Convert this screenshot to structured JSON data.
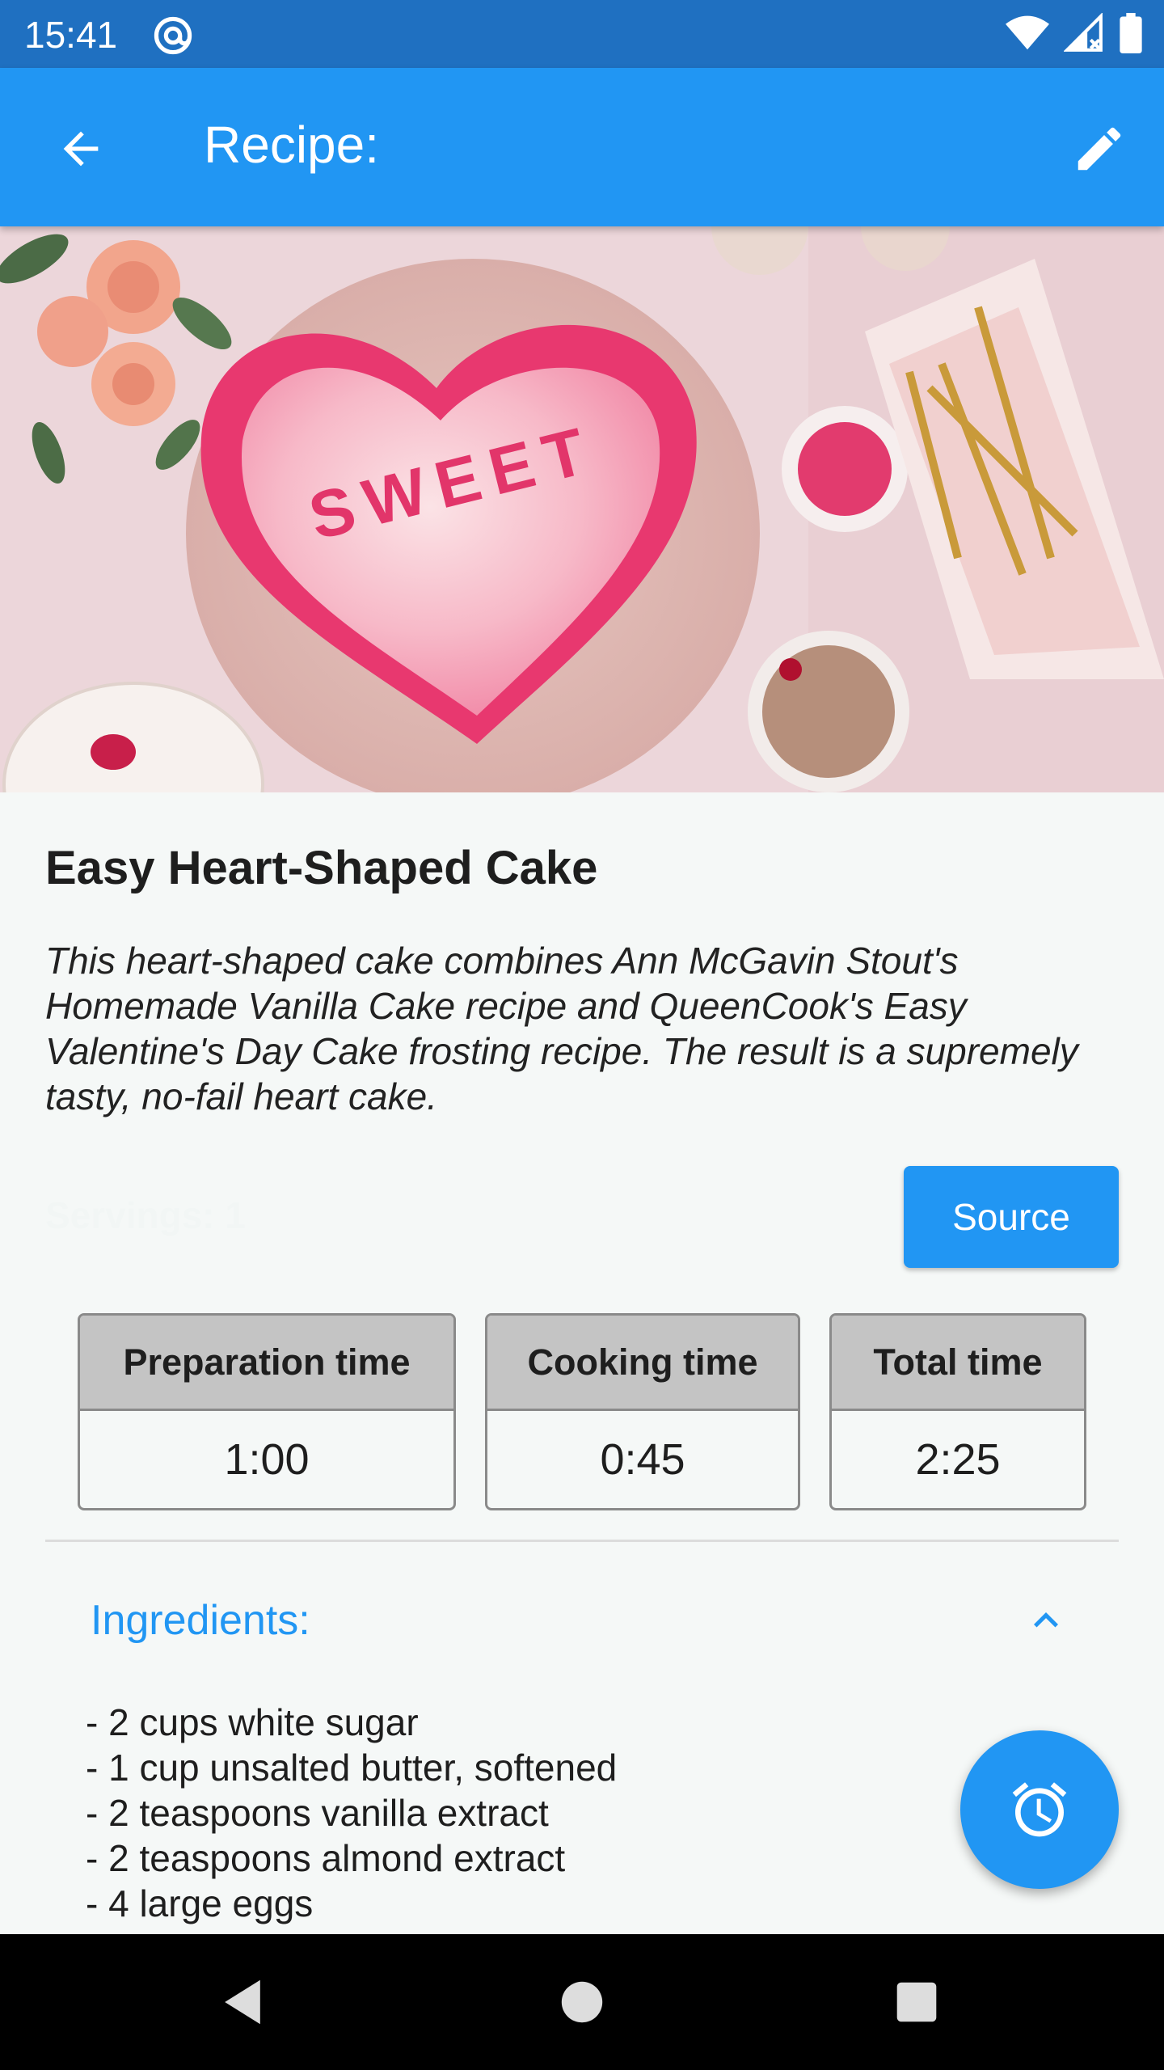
{
  "status_bar": {
    "time": "15:41",
    "icons": [
      "at-sign-icon",
      "wifi-icon",
      "cellular-signal-icon",
      "battery-icon"
    ]
  },
  "app_bar": {
    "title": "Recipe:",
    "back_icon": "arrow-back-icon",
    "edit_icon": "edit-pencil-icon",
    "color": "#2196f3"
  },
  "hero": {
    "image": "photo of heart-shaped cake with pink frosting",
    "cake_text": "SWEET"
  },
  "recipe": {
    "title": "Easy Heart-Shaped Cake",
    "description": "This heart-shaped cake combines Ann McGavin Stout's Homemade Vanilla Cake recipe and QueenCook's Easy Valentine's Day Cake frosting recipe. The result is a supremely tasty, no-fail heart cake.",
    "servings": "Servings: 1",
    "source_label": "Source"
  },
  "times": [
    {
      "label": "Preparation time",
      "value": "1:00"
    },
    {
      "label": "Cooking time",
      "value": "0:45"
    },
    {
      "label": "Total time",
      "value": "2:25"
    }
  ],
  "ingredients": {
    "title": "Ingredients:",
    "expanded": true,
    "items": [
      "-  2 cups white sugar",
      "-  1 cup unsalted butter, softened",
      "-  2 teaspoons vanilla extract",
      "-  2 teaspoons almond extract",
      "-  4 large eggs"
    ]
  },
  "fab": {
    "icon": "alarm-clock-icon"
  },
  "nav_bar": {
    "icons": [
      "back-triangle-icon",
      "home-circle-icon",
      "recents-square-icon"
    ]
  }
}
